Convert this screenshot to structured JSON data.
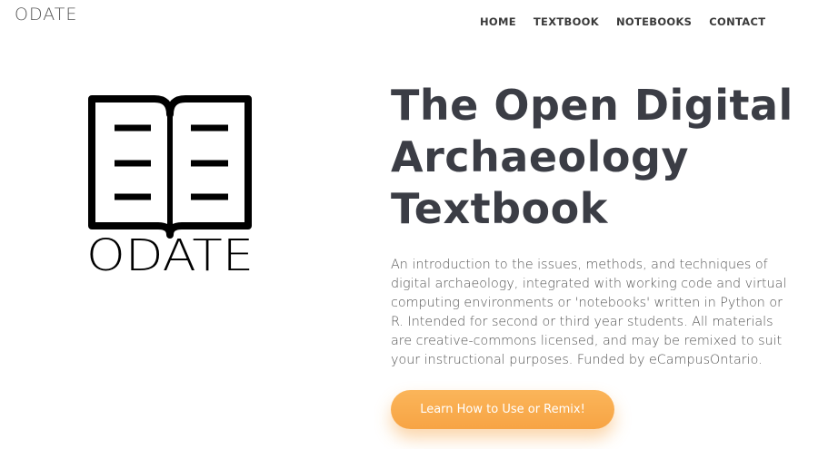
{
  "header": {
    "brand": "ODATE",
    "nav": [
      "HOME",
      "TEXTBOOK",
      "NOTEBOOKS",
      "CONTACT"
    ]
  },
  "logo": {
    "text": "ODATE",
    "icon": "open-book-icon"
  },
  "hero": {
    "title": "The Open Digital Archaeology Textbook",
    "description": "An introduction to the issues, methods, and techniques of digital archaeology, integrated with working code and virtual computing environments or 'notebooks' written in Python or R. Intended for second or third year students. All materials are creative-commons licensed, and may be remixed to suit your instructional purposes. Funded by eCampusOntario.",
    "cta_label": "Learn How to Use or Remix!"
  },
  "colors": {
    "accent": "#f7a444",
    "text": "#3b3d45"
  }
}
